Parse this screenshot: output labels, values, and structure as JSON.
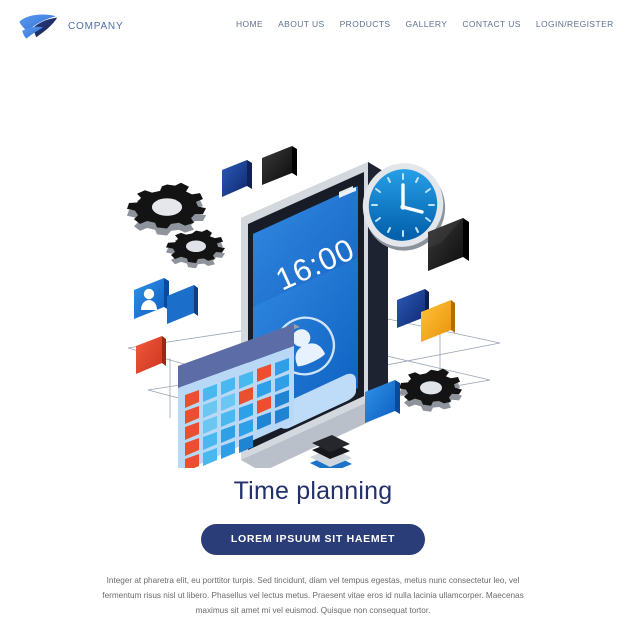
{
  "header": {
    "logo_icon": "wing-logo-icon",
    "brand_name": "COMPANY",
    "nav_items": [
      {
        "label": "HOME"
      },
      {
        "label": "ABOUT US"
      },
      {
        "label": "PRODUCTS"
      },
      {
        "label": "GALLERY"
      },
      {
        "label": "CONTACT US"
      },
      {
        "label": "LOGIN/REGISTER"
      }
    ]
  },
  "illustration": {
    "style": "isometric-flat-3d",
    "phone": {
      "time_display": "16:00",
      "status_icon": "signal-bars-icon",
      "battery_icon": "battery-icon",
      "avatar_icon": "user-avatar-icon",
      "screen_gradient_from": "#2f86e0",
      "screen_gradient_to": "#1769c8",
      "body_color": "#1d2330"
    },
    "clock": {
      "icon": "analog-clock-icon",
      "hour_hand": 4,
      "minute_hand": 0,
      "face_color": "#0b8fe3",
      "rim_color": "#d9dde4"
    },
    "calendar": {
      "icon": "calendar-icon",
      "header_color": "#5b6ca6",
      "body_color": "#b9d8f5",
      "cell_colors": [
        "#e8502f",
        "#49b8ef",
        "#2f9fe8",
        "#1f84d2"
      ],
      "rows": 5,
      "columns": 6
    },
    "gears": [
      {
        "name": "gear-large-icon",
        "color": "#1c1c1c"
      },
      {
        "name": "gear-small-icon",
        "color": "#1c1c1c"
      },
      {
        "name": "gear-right-icon",
        "color": "#1c1c1c"
      }
    ],
    "floating_cards": [
      {
        "name": "card-blue-user",
        "color": "#1f7fd4",
        "icon": "user-icon"
      },
      {
        "name": "card-blue-plain",
        "color": "#1166c4"
      },
      {
        "name": "card-red",
        "color": "#e0432c"
      },
      {
        "name": "card-navy-top",
        "color": "#1e4fa8"
      },
      {
        "name": "card-black-large",
        "color": "#1b1b1b"
      },
      {
        "name": "card-navy-right",
        "color": "#1a3e8c"
      },
      {
        "name": "card-orange",
        "color": "#f2a416"
      },
      {
        "name": "card-blue-lower-right",
        "color": "#1a7fd6"
      },
      {
        "name": "card-stack-black",
        "color": "#1b1b1b"
      }
    ],
    "ground_lines_color": "#9aa3b4"
  },
  "content": {
    "headline": "Time planning",
    "cta_label": "LOREM IPSUUM SIT HAEMET",
    "cta_color": "#2b3d79",
    "paragraph": "Integer at pharetra elit, eu porttitor turpis. Sed tincidunt, diam vel tempus egestas, metus nunc consectetur leo, vel fermentum risus nisl ut libero. Phasellus vel lectus metus. Praesent vitae eros id nulla lacinia ullamcorper. Maecenas maximus sit amet mi vel euismod. Quisque non consequat tortor."
  },
  "theme": {
    "background": "#ffffff",
    "brand_blue": "#4b6fa8",
    "nav_text": "#5f7290",
    "headline_color": "#23316b",
    "body_text_color": "#6b6b6b"
  }
}
